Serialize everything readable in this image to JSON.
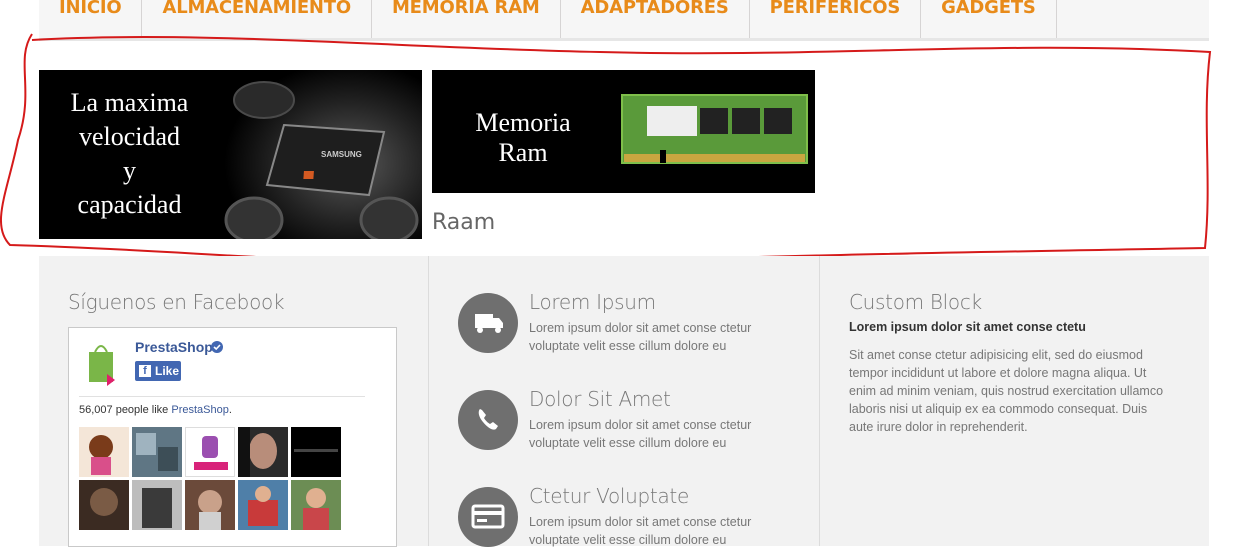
{
  "nav": {
    "items": [
      {
        "label": "INICIO"
      },
      {
        "label": "ALMACENAMIENTO"
      },
      {
        "label": "MEMORIA RAM"
      },
      {
        "label": "ADAPTADORES"
      },
      {
        "label": "PERIFERICOS"
      },
      {
        "label": "GADGETS"
      }
    ],
    "color": "#e88b1a"
  },
  "banners": {
    "banner1": {
      "lines": [
        "La maxima",
        "velocidad",
        "y",
        "capacidad"
      ],
      "product_brand": "SAMSUNG"
    },
    "banner2": {
      "lines": [
        "Memoria",
        "Ram"
      ],
      "caption": "Raam"
    }
  },
  "footer": {
    "facebook": {
      "title": "Síguenos en Facebook",
      "page_name": "PrestaShop",
      "like_label": "Like",
      "like_count_text": "56,007 people like ",
      "like_count_link": "PrestaShop",
      "like_count_end": "."
    },
    "features": [
      {
        "title": "Lorem Ipsum",
        "text": "Lorem ipsum dolor sit amet conse ctetur voluptate velit esse cillum dolore eu",
        "icon": "truck-icon"
      },
      {
        "title": "Dolor Sit Amet",
        "text": "Lorem ipsum dolor sit amet conse ctetur voluptate velit esse cillum dolore eu",
        "icon": "phone-icon"
      },
      {
        "title": "Ctetur Voluptate",
        "text": "Lorem ipsum dolor sit amet conse ctetur voluptate velit esse cillum dolore eu",
        "icon": "credit-card-icon"
      }
    ],
    "custom_block": {
      "title": "Custom Block",
      "subtitle": "Lorem ipsum dolor sit amet conse ctetu",
      "text": "Sit amet conse ctetur adipisicing elit, sed do eiusmod tempor incididunt ut labore et dolore magna aliqua. Ut enim ad minim veniam, quis nostrud exercitation ullamco laboris nisi ut aliquip ex ea commodo consequat. Duis aute irure dolor in reprehenderit."
    }
  }
}
